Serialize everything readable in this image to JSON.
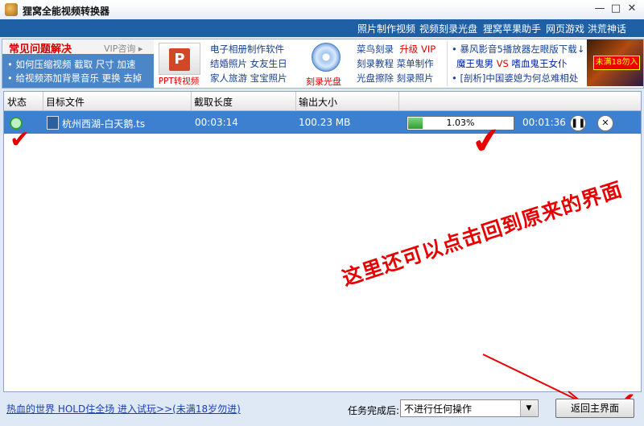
{
  "window": {
    "title": "狸窝全能视频转换器",
    "controls": {
      "minimize": "—",
      "maximize": "□",
      "close": "✕"
    }
  },
  "top_links": [
    "照片制作视频",
    "视频刻录光盘",
    "狸窝苹果助手",
    "网页游戏 洪荒神话"
  ],
  "ad_strip": {
    "faq": {
      "title": "常见问题解决",
      "vip": "VIP咨询 ▸",
      "row1": "• 如何压缩视频  截取  尺寸  加速",
      "row2": "• 给视频添加背景音乐  更换  去掉"
    },
    "ppt_caption": "PPT转视频",
    "col2": [
      "电子相册制作软件",
      "结婚照片  女友生日",
      "家人旅游  宝宝照片"
    ],
    "cd_caption": "刻录光盘",
    "col3": {
      "row1_a": "菜鸟刻录",
      "row1_b": "升级 VIP",
      "row2": "刻录教程  菜单制作",
      "row3": "光盘擦除  刻录照片"
    },
    "col4": {
      "row1": "• 暴风影音5播放器左眼版下载↓",
      "row2_a": "魔王鬼男",
      "row2_vs": "VS",
      "row2_b": "嗜血鬼王女仆",
      "row3": "• [剖析]中国婆媳为何总难相处"
    },
    "game_badge": "未满18勿入"
  },
  "table": {
    "headers": [
      "状态",
      "目标文件",
      "截取长度",
      "输出大小"
    ],
    "rows": [
      {
        "filename": "杭州西湖-白天鹅.ts",
        "length": "00:03:14",
        "size": "100.23 MB",
        "progress_text": "1.03%",
        "progress_value": 0.0103,
        "remaining": "00:01:36"
      }
    ]
  },
  "annotations": {
    "check": "✔",
    "note": "这里还可以点击回到原来的界面"
  },
  "bottom": {
    "link": "热血的世界 HOLD住全场 进入试玩>>(未满18岁勿进)",
    "after_label": "任务完成后:",
    "after_value": "不进行任何操作",
    "back_button": "返回主界面"
  },
  "icons": {
    "status": "converting-status-icon",
    "file": "video-file-icon",
    "pause": "pause-icon",
    "cancel": "close-icon"
  },
  "colors": {
    "selected_row": "#3d80cf",
    "annotation_red": "#e80000",
    "progress_green": "#2e9e2e"
  }
}
